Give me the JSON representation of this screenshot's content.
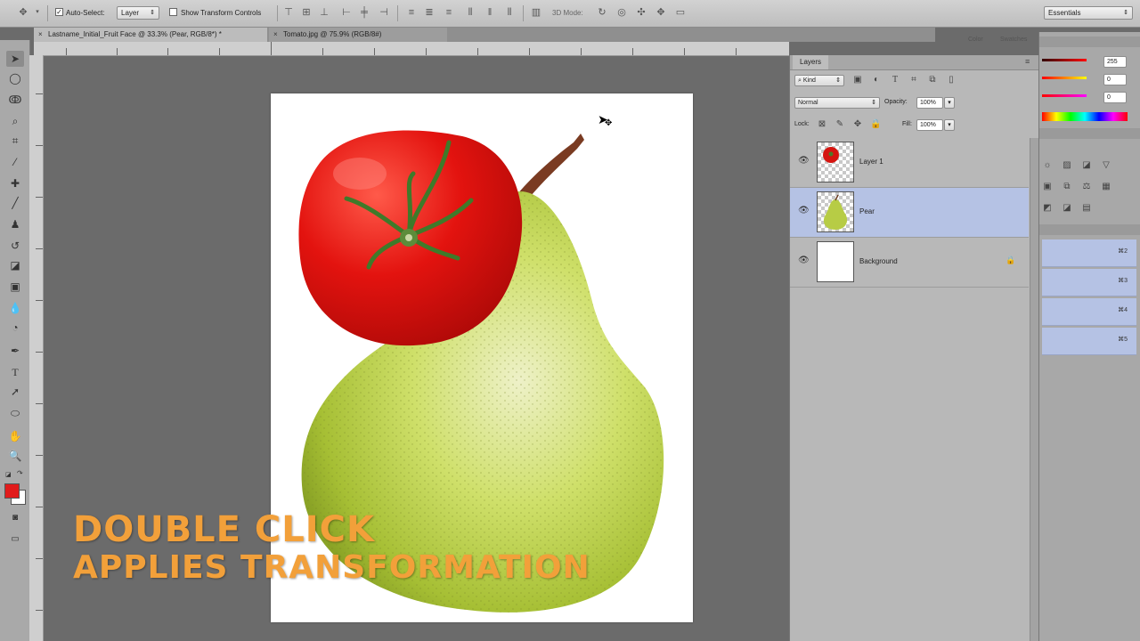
{
  "options_bar": {
    "auto_select_label": "Auto-Select:",
    "auto_select_checked": true,
    "auto_select_target": "Layer",
    "show_transform_controls_label": "Show Transform Controls",
    "show_transform_checked": false,
    "mode_3d_label": "3D Mode:",
    "workspace": "Essentials"
  },
  "tabs": [
    {
      "label": "Lastname_Initial_Fruit Face @ 33.3% (Pear, RGB/8*) *",
      "active": true
    },
    {
      "label": "Tomato.jpg @ 75.9% (RGB/8#)",
      "active": false
    }
  ],
  "tools": [
    "move-tool",
    "marquee-tool",
    "lasso-tool",
    "quick-select-tool",
    "crop-tool",
    "eyedropper-tool",
    "healing-brush-tool",
    "brush-tool",
    "clone-stamp-tool",
    "history-brush-tool",
    "eraser-tool",
    "gradient-tool",
    "blur-tool",
    "dodge-tool",
    "pen-tool",
    "type-tool",
    "path-select-tool",
    "shape-tool",
    "hand-tool",
    "zoom-tool"
  ],
  "colors": {
    "foreground": "#e11b1b",
    "background": "#ffffff",
    "selected_layer": "#b5c2e4",
    "caption": "#f2a03a"
  },
  "layers_panel": {
    "title": "Layers",
    "filter_kind": "Kind",
    "blend_mode": "Normal",
    "opacity_label": "Opacity:",
    "opacity_value": "100%",
    "lock_label": "Lock:",
    "fill_label": "Fill:",
    "fill_value": "100%",
    "layers": [
      {
        "name": "Layer 1",
        "visible": true,
        "selected": false,
        "locked": false,
        "thumb": "tomato"
      },
      {
        "name": "Pear",
        "visible": true,
        "selected": true,
        "locked": false,
        "thumb": "pear"
      },
      {
        "name": "Background",
        "visible": true,
        "selected": false,
        "locked": true,
        "thumb": "white"
      }
    ]
  },
  "dock": {
    "color_tab": "Color",
    "swatches_tab": "Swatches",
    "color_values": [
      "255",
      "0",
      "0"
    ],
    "shortcuts": [
      "⌘2",
      "⌘3",
      "⌘4",
      "⌘5"
    ]
  },
  "caption": {
    "line1": "DOUBLE CLICK",
    "line2": "APPLIES TRANSFORMATION"
  }
}
